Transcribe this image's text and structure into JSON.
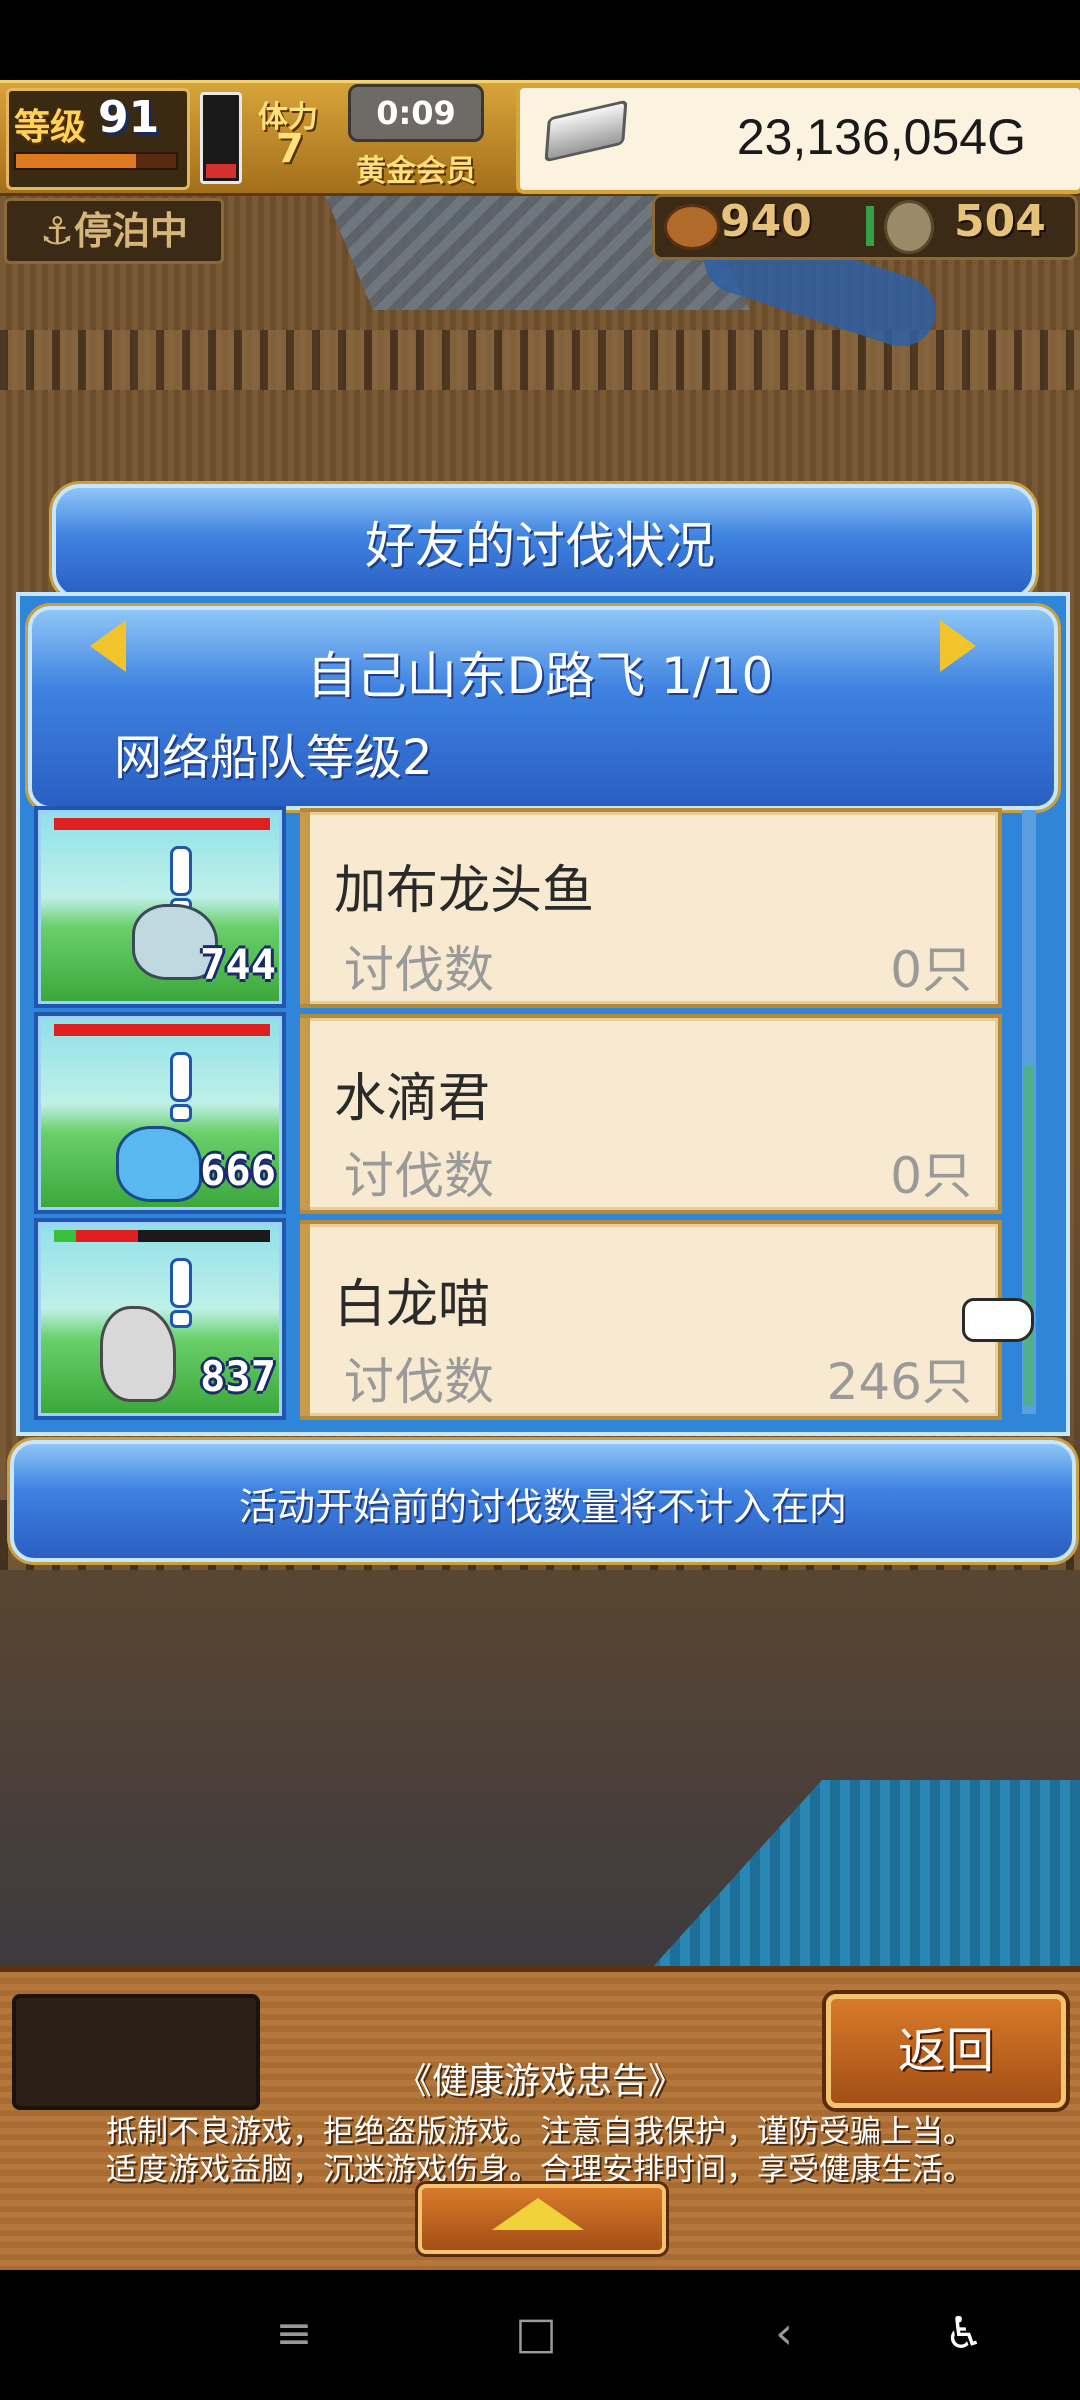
{
  "hud": {
    "level_label": "等级",
    "level_value": "91",
    "stamina_label": "体力",
    "stamina_value": "7",
    "timer": "0:09",
    "membership": "黄金会员",
    "gold": "23,136,054G"
  },
  "status": {
    "docked": "⚓停泊中",
    "food": "940",
    "wood": "504"
  },
  "dialog": {
    "title": "好友的讨伐状况",
    "friend_name": "自己山东D路飞 1/10",
    "fleet_level": "网络船队等级2",
    "notice": "活动开始前的讨伐数量将不计入在内",
    "monsters": [
      {
        "name": "加布龙头鱼",
        "kill_label": "讨伐数",
        "kill_count": "0只",
        "number": "744",
        "hp_fraction": 1.0,
        "sprite_color": "#c0d8e0"
      },
      {
        "name": "水滴君",
        "kill_label": "讨伐数",
        "kill_count": "0只",
        "number": "666",
        "hp_fraction": 1.0,
        "sprite_color": "#5ab8f0"
      },
      {
        "name": "白龙喵",
        "kill_label": "讨伐数",
        "kill_count": "246只",
        "number": "837",
        "hp_fraction": 0.45,
        "sprite_color": "#d8d8d8"
      }
    ]
  },
  "bottom": {
    "back": "返回",
    "health_title": "《健康游戏忠告》",
    "health_line1": "抵制不良游戏，拒绝盗版游戏。注意自我保护，谨防受骗上当。",
    "health_line2": "适度游戏益脑，沉迷游戏伤身。合理安排时间，享受健康生活。"
  },
  "navbar": {
    "menu": "≡",
    "home": "□",
    "back": "‹",
    "accessibility": "♿"
  },
  "colors": {
    "dialog_blue": "#3f82e0",
    "card_bg": "#f8ead0",
    "gold_accent": "#f2c42c"
  }
}
